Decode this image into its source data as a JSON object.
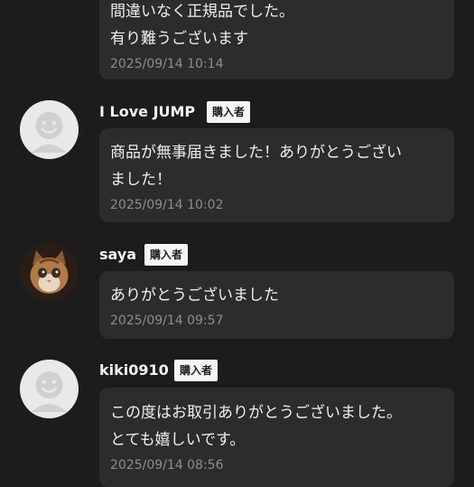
{
  "badge_label": "購入者",
  "comments": [
    {
      "username": "",
      "text": "間違いなく正規品でした。\n有り難うございます",
      "time": "2025/09/14 10:14"
    },
    {
      "username": "I Love JUMP",
      "avatar": "default-avatar-icon",
      "text": "商品が無事届きました！ありがとうござい\nました！",
      "time": "2025/09/14 10:02"
    },
    {
      "username": "saya",
      "avatar": "kitten-photo",
      "text": "ありがとうございました",
      "time": "2025/09/14 09:57"
    },
    {
      "username": "kiki0910",
      "avatar": "default-avatar-icon",
      "text": "この度はお取引ありがとうございました。\nとても嬉しいです。",
      "time": "2025/09/14 08:56"
    }
  ]
}
